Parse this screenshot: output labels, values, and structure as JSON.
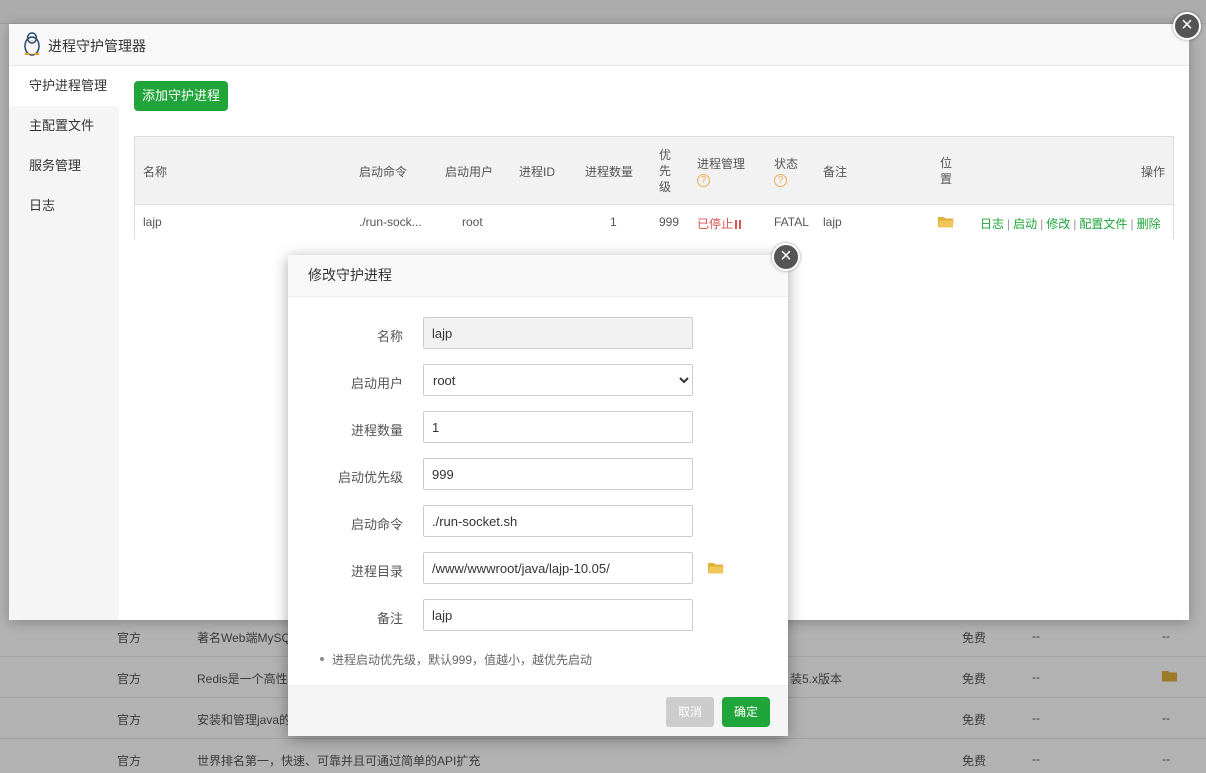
{
  "manager": {
    "title": "进程守护管理器",
    "sidebar": [
      "守护进程管理",
      "主配置文件",
      "服务管理",
      "日志"
    ],
    "add_button": "添加守护进程",
    "table": {
      "headers": {
        "name": "名称",
        "command": "启动命令",
        "user": "启动用户",
        "pid": "进程ID",
        "count": "进程数量",
        "priority": "优先级",
        "manage": "进程管理",
        "state": "状态",
        "note": "备注",
        "location": "位置",
        "ops": "操作"
      },
      "row": {
        "name": "lajp",
        "command": "./run-sock...",
        "user": "root",
        "pid": "",
        "count": "1",
        "priority": "999",
        "manage": "已停止",
        "state": "FATAL",
        "note": "lajp",
        "ops": [
          "日志",
          "启动",
          "修改",
          "配置文件",
          "删除"
        ]
      }
    }
  },
  "dialog": {
    "title": "修改守护进程",
    "fields": {
      "name": {
        "label": "名称",
        "value": "lajp"
      },
      "user": {
        "label": "启动用户",
        "value": "root"
      },
      "count": {
        "label": "进程数量",
        "value": "1"
      },
      "priority": {
        "label": "启动优先级",
        "value": "999"
      },
      "command": {
        "label": "启动命令",
        "value": "./run-socket.sh"
      },
      "dir": {
        "label": "进程目录",
        "value": "/www/wwwroot/java/lajp-10.05/"
      },
      "note": {
        "label": "备注",
        "value": "lajp"
      }
    },
    "hint": "进程启动优先级，默认999，值越小，越优先启动",
    "cancel": "取消",
    "ok": "确定"
  },
  "background_rows": [
    {
      "type": "官方",
      "desc": "著名Web端MySQ",
      "price": "免费",
      "a": "--",
      "b": "--"
    },
    {
      "type": "官方",
      "desc": "Redis是一个高性",
      "extra": "装5.x版本",
      "price": "免费",
      "a": "--",
      "b": ""
    },
    {
      "type": "官方",
      "desc": "安装和管理java的",
      "price": "免费",
      "a": "--",
      "b": "--"
    },
    {
      "type": "官方",
      "desc": "世界排名第一，快速、可靠并且可通过简单的API扩充",
      "price": "免费",
      "a": "--",
      "b": "--"
    }
  ],
  "colors": {
    "accent": "#20a53a",
    "stopped": "#d9534f",
    "folder": "#e0b13a"
  }
}
